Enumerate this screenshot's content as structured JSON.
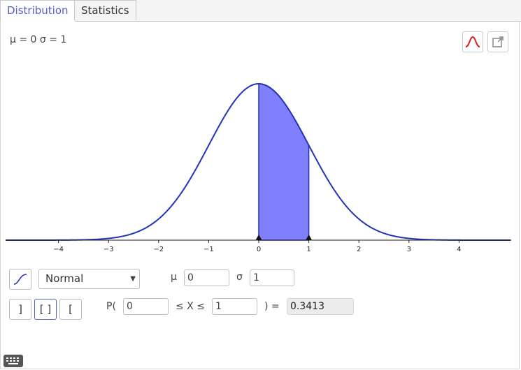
{
  "tabs": [
    {
      "label": "Distribution"
    },
    {
      "label": "Statistics"
    }
  ],
  "params_display": "μ = 0 σ = 1",
  "icons": {
    "curve_style": "normal-curve-icon",
    "export": "export-icon",
    "cumulative": "cumulative-toggle-icon",
    "keyboard": "keyboard-icon"
  },
  "distribution": {
    "selected": "Normal",
    "mu_label": "μ",
    "mu_value": "0",
    "sigma_label": "σ",
    "sigma_value": "1"
  },
  "probability": {
    "p_open": "P(",
    "lower": "0",
    "between": "≤ X ≤",
    "upper": "1",
    "close_eq": ") =",
    "result": "0.3413"
  },
  "interval_buttons": [
    {
      "label": "]",
      "mode": "left-sided"
    },
    {
      "label": "[ ]",
      "mode": "interval"
    },
    {
      "label": "[",
      "mode": "right-sided"
    }
  ],
  "colors": {
    "accent": "#5560c9",
    "curve": "#2433b8",
    "fill": "#8080ff",
    "curve_icon": "#e02020"
  },
  "chart_data": {
    "type": "area",
    "distribution": "normal",
    "mu": 0,
    "sigma": 1,
    "xlim": [
      -5,
      5
    ],
    "shaded_interval": [
      0,
      1
    ],
    "x_ticks": [
      -4,
      -3,
      -2,
      -1,
      0,
      1,
      2,
      3,
      4
    ],
    "tick_labels": [
      "−4",
      "−3",
      "−2",
      "−1",
      "0",
      "1",
      "2",
      "3",
      "4"
    ]
  }
}
